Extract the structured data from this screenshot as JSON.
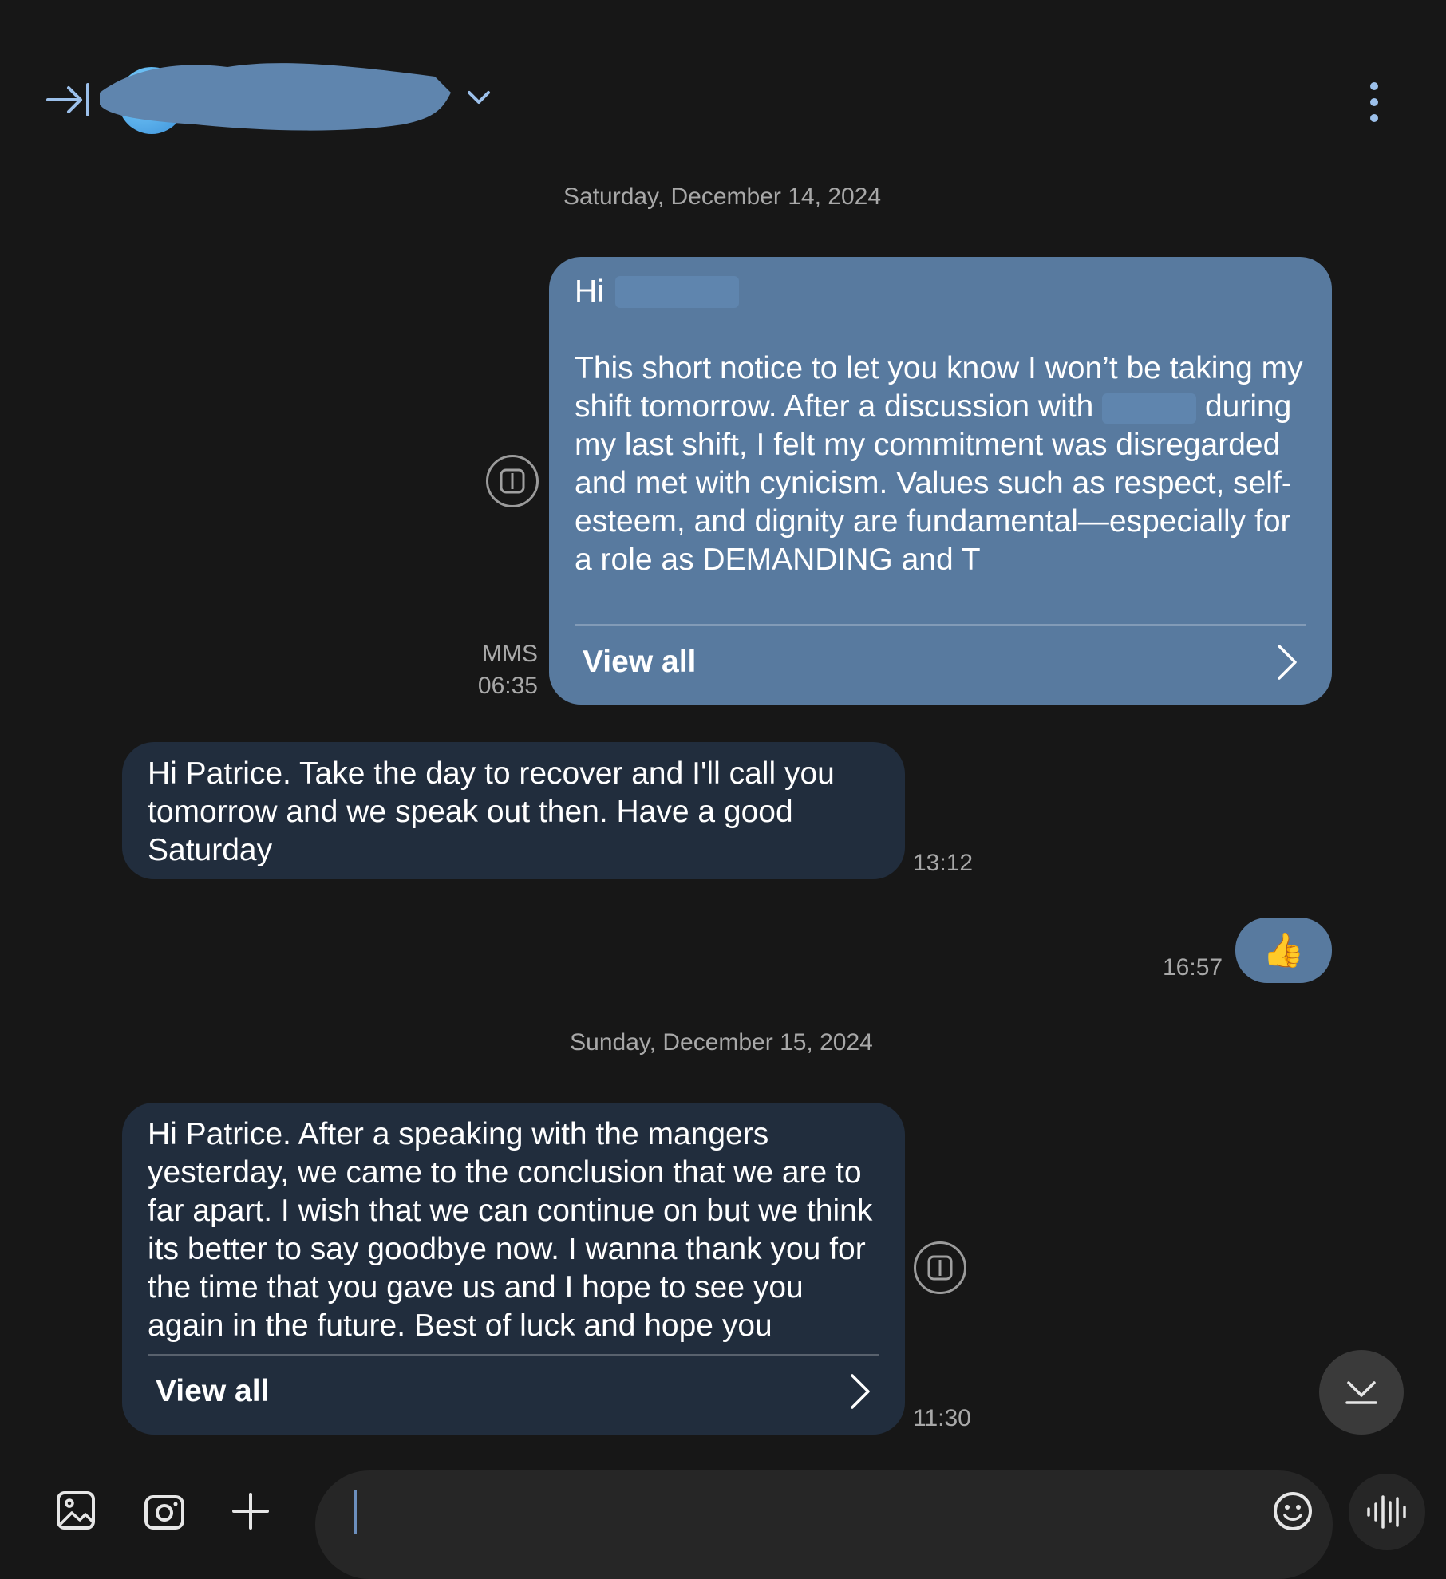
{
  "header": {
    "contact_name": "",
    "back_icon": "collapse-right-icon",
    "more_icon": "more-vertical-icon"
  },
  "colors": {
    "background": "#171717",
    "outgoing_bubble": "#587a9f",
    "incoming_bubble": "#212d3d",
    "meta_text": "#a8a8a8"
  },
  "conversation": {
    "date_1": "Saturday, December 14, 2024",
    "date_2": "Sunday, December 15, 2024",
    "messages": [
      {
        "direction": "outgoing",
        "greeting": "Hi",
        "paragraph_start": "This short notice to let you know I won’t be taking my shift tomorrow. After a discussion with",
        "paragraph_end": "during my last shift, I felt my commitment was disregarded and met with cynicism. Values such as respect, self-esteem, and dignity are fundamental—especially for a role as DEMANDING and T",
        "view_all_label": "View all",
        "type_label": "MMS",
        "time": "06:35"
      },
      {
        "direction": "incoming",
        "text": "Hi Patrice. Take the day to recover and I'll call you tomorrow and we speak out then. Have a good Saturday",
        "time": "13:12"
      },
      {
        "direction": "outgoing",
        "emoji": "👍",
        "time": "16:57"
      },
      {
        "direction": "incoming",
        "text": "Hi Patrice. After a speaking with the mangers yesterday, we came to the conclusion that we are to far apart. I wish that we can continue on but we think its better to say goodbye now. I wanna thank you for the time that you gave us and I hope to see you again in the future. Best of luck and hope you",
        "view_all_label": "View all",
        "time": "11:30"
      }
    ]
  },
  "composer": {
    "placeholder": "",
    "gallery_icon": "image-icon",
    "camera_icon": "camera-icon",
    "add_icon": "plus-icon",
    "emoji_icon": "smiley-icon",
    "voice_icon": "voice-waveform-icon"
  }
}
